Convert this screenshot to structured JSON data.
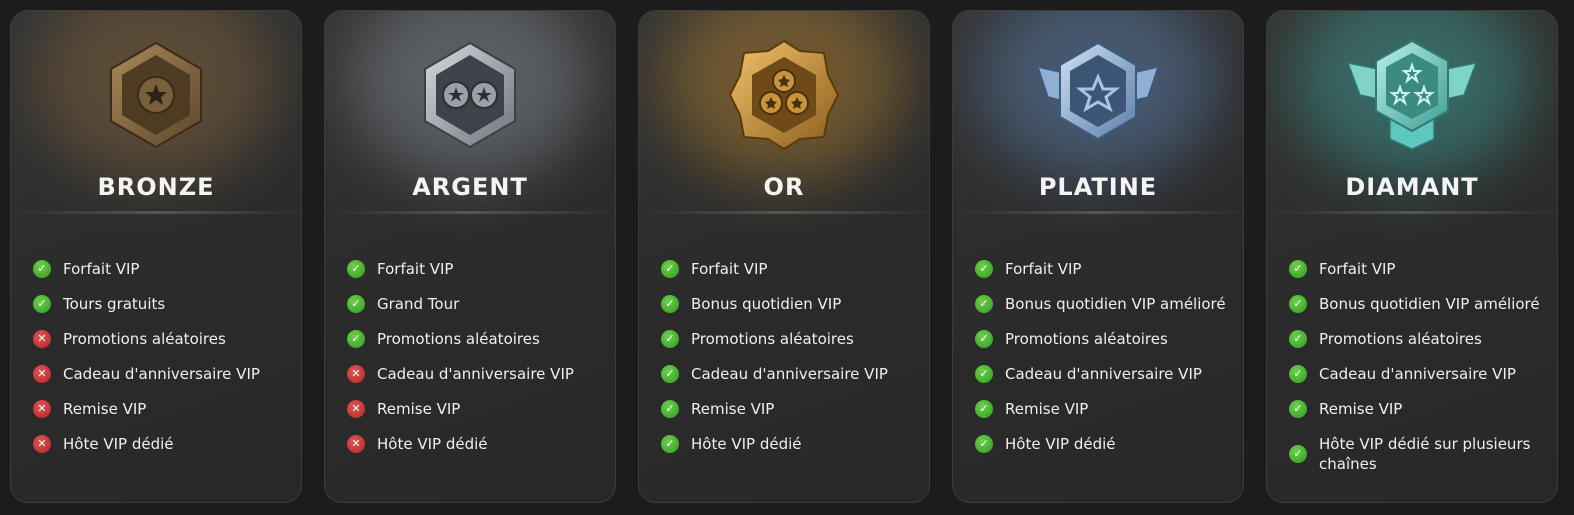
{
  "tiers": [
    {
      "name": "BRONZE",
      "badge_icon": "bronze-badge-icon",
      "accent": "#7a6446",
      "features": [
        {
          "label": "Forfait VIP",
          "included": true
        },
        {
          "label": "Tours gratuits",
          "included": true
        },
        {
          "label": "Promotions aléatoires",
          "included": false
        },
        {
          "label": "Cadeau d'anniversaire VIP",
          "included": false
        },
        {
          "label": "Remise VIP",
          "included": false
        },
        {
          "label": "Hôte VIP dédié",
          "included": false
        }
      ]
    },
    {
      "name": "ARGENT",
      "badge_icon": "silver-badge-icon",
      "accent": "#9aa1a8",
      "features": [
        {
          "label": "Forfait VIP",
          "included": true
        },
        {
          "label": "Grand Tour",
          "included": true
        },
        {
          "label": "Promotions aléatoires",
          "included": true
        },
        {
          "label": "Cadeau d'anniversaire VIP",
          "included": false
        },
        {
          "label": "Remise VIP",
          "included": false
        },
        {
          "label": "Hôte VIP dédié",
          "included": false
        }
      ]
    },
    {
      "name": "OR",
      "badge_icon": "gold-badge-icon",
      "accent": "#c9953a",
      "features": [
        {
          "label": "Forfait VIP",
          "included": true
        },
        {
          "label": "Bonus quotidien VIP",
          "included": true
        },
        {
          "label": "Promotions aléatoires",
          "included": true
        },
        {
          "label": "Cadeau d'anniversaire VIP",
          "included": true
        },
        {
          "label": "Remise VIP",
          "included": true
        },
        {
          "label": "Hôte VIP dédié",
          "included": true
        }
      ]
    },
    {
      "name": "PLATINE",
      "badge_icon": "platinum-badge-icon",
      "accent": "#7fa6d4",
      "features": [
        {
          "label": "Forfait VIP",
          "included": true
        },
        {
          "label": "Bonus quotidien VIP amélioré",
          "included": true
        },
        {
          "label": "Promotions aléatoires",
          "included": true
        },
        {
          "label": "Cadeau d'anniversaire VIP",
          "included": true
        },
        {
          "label": "Remise VIP",
          "included": true
        },
        {
          "label": "Hôte VIP dédié",
          "included": true
        }
      ]
    },
    {
      "name": "DIAMANT",
      "badge_icon": "diamond-badge-icon",
      "accent": "#5fc7bd",
      "features": [
        {
          "label": "Forfait VIP",
          "included": true
        },
        {
          "label": "Bonus quotidien VIP amélioré",
          "included": true
        },
        {
          "label": "Promotions aléatoires",
          "included": true
        },
        {
          "label": "Cadeau d'anniversaire VIP",
          "included": true
        },
        {
          "label": "Remise VIP",
          "included": true
        },
        {
          "label": "Hôte VIP dédié sur plusieurs chaînes",
          "included": true
        }
      ]
    }
  ],
  "icons": {
    "included": "check-icon",
    "excluded": "cross-icon"
  }
}
